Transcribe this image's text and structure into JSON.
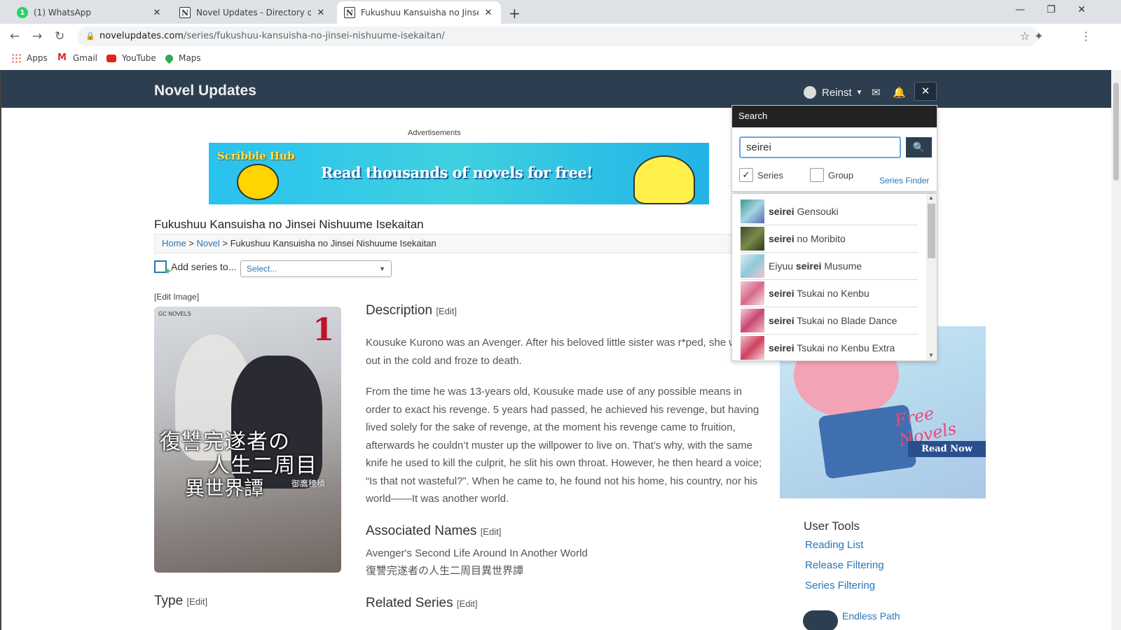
{
  "browser": {
    "tabs": [
      {
        "title": "(1) WhatsApp",
        "favicon": "whatsapp-icon",
        "active": false
      },
      {
        "title": "Novel Updates - Directory of Asia",
        "favicon": "novelupdates-icon",
        "active": false
      },
      {
        "title": "Fukushuu Kansuisha no Jinsei Ni",
        "favicon": "novelupdates-icon",
        "active": true
      }
    ],
    "url_host": "novelupdates.com",
    "url_path": "/series/fukushuu-kansuisha-no-jinsei-nishuume-isekaitan/",
    "bookmarks": [
      {
        "label": "Apps",
        "icon": "apps-grid-icon"
      },
      {
        "label": "Gmail",
        "icon": "gmail-icon"
      },
      {
        "label": "YouTube",
        "icon": "youtube-icon"
      },
      {
        "label": "Maps",
        "icon": "maps-pin-icon"
      }
    ]
  },
  "header": {
    "logo": "Novel Updates",
    "username": "Reinst"
  },
  "search": {
    "title": "Search",
    "query": "seirei",
    "series_label": "Series",
    "series_checked": true,
    "group_label": "Group",
    "group_checked": false,
    "series_finder": "Series Finder",
    "results": [
      {
        "pre": "",
        "match": "seirei",
        "post": " Gensouki"
      },
      {
        "pre": "",
        "match": "seirei",
        "post": " no Moribito"
      },
      {
        "pre": "Eiyuu ",
        "match": "seirei",
        "post": " Musume"
      },
      {
        "pre": "",
        "match": "seirei",
        "post": " Tsukai no Kenbu"
      },
      {
        "pre": "",
        "match": "seirei",
        "post": " Tsukai no Blade Dance"
      },
      {
        "pre": "",
        "match": "seirei",
        "post": " Tsukai no Kenbu Extra"
      }
    ]
  },
  "ads": {
    "label": "Advertisements",
    "banner_brand": "Scribble Hub",
    "banner_tagline": "Read thousands of novels for free!",
    "side_text": "Free Novels",
    "side_button": "Read Now"
  },
  "series": {
    "title": "Fukushuu Kansuisha no Jinsei Nishuume Isekaitan",
    "breadcrumb": {
      "home": "Home",
      "novel": "Novel",
      "current": "Fukushuu Kansuisha no Jinsei Nishuume Isekaitan"
    },
    "add_series_label": "Add series to...",
    "select_placeholder": "Select...",
    "edit_image": "[Edit Image]",
    "cover": {
      "publisher": "GC NOVELS",
      "volume": "1",
      "title_line1": "復讐完遂者の",
      "title_line2": "人生二周目",
      "title_line3": "異世界譚",
      "author": "御鷹穂積"
    },
    "description_heading": "Description",
    "edit_tag": "[Edit]",
    "description": [
      "Kousuke Kurono was an Avenger. After his beloved little sister was r*ped, she was left out in the cold and froze to death.",
      "From the time he was 13-years old, Kousuke made use of any possible means in order to exact his revenge. 5 years had passed, he achieved his revenge, but having lived solely for the sake of revenge, at the moment his revenge came to fruition, afterwards he couldn’t muster up the willpower to live on. That’s why, with the same knife he used to kill the culprit, he slit his own throat. However, he then heard a voice; “Is that not wasteful?”. When he came to, he found not his home, his country, nor his world——It was another world."
    ],
    "associated_heading": "Associated Names",
    "associated_names": [
      "Avenger's Second Life Around In Another World",
      "復讐完遂者の人生二周目異世界譚"
    ],
    "type_heading": "Type",
    "related_heading": "Related Series"
  },
  "user_tools": {
    "heading": "User Tools",
    "links": [
      "Reading List",
      "Release Filtering",
      "Series Filtering"
    ],
    "next_item": "Endless Path"
  }
}
